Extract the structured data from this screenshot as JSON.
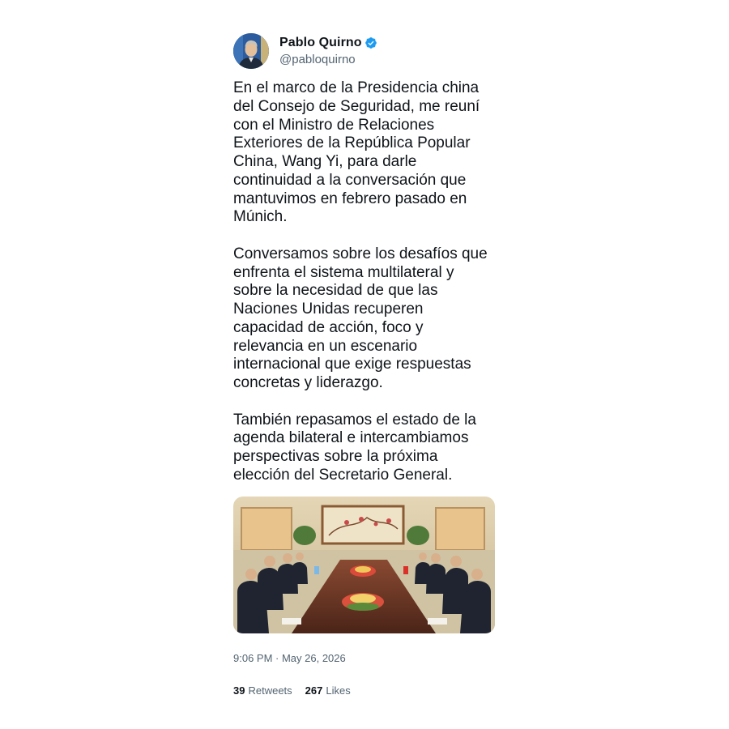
{
  "author": {
    "display_name": "Pablo Quirno",
    "handle": "@pabloquirno",
    "verified": true,
    "avatar_icon": "profile-photo"
  },
  "tweet": {
    "paragraphs": [
      "En el marco de la Presidencia china\ndel Consejo de Seguridad, me reuní\ncon el Ministro de Relaciones\nExteriores de la República Popular\nChina, Wang Yi, para darle\ncontinuidad a la conversación que\nmantuvimos en febrero pasado en\nMúnich.",
      "Conversamos sobre los desafíos que\nenfrenta el sistema multilateral y\nsobre la necesidad de que las\nNaciones Unidas recuperen\ncapacidad de acción, foco y\nrelevancia en un escenario\ninternacional que exige respuestas\nconcretas y liderazgo.",
      "También repasamos el estado de la\nagenda bilateral e intercambiamos\nperspectivas sobre la próxima\nelección del Secretario General."
    ],
    "media": {
      "type": "photo",
      "colors": {
        "wall": "#d8c7a3",
        "table": "#6b3a2a",
        "suits": "#1f2430"
      }
    },
    "timestamp": "9:06 PM · May 26, 2026"
  },
  "stats": {
    "retweets_count": "39",
    "retweets_label": "Retweets",
    "likes_count": "267",
    "likes_label": "Likes"
  },
  "colors": {
    "verified_badge": "#1d9bf0",
    "secondary_text": "#536471",
    "primary_text": "#0f1419"
  }
}
